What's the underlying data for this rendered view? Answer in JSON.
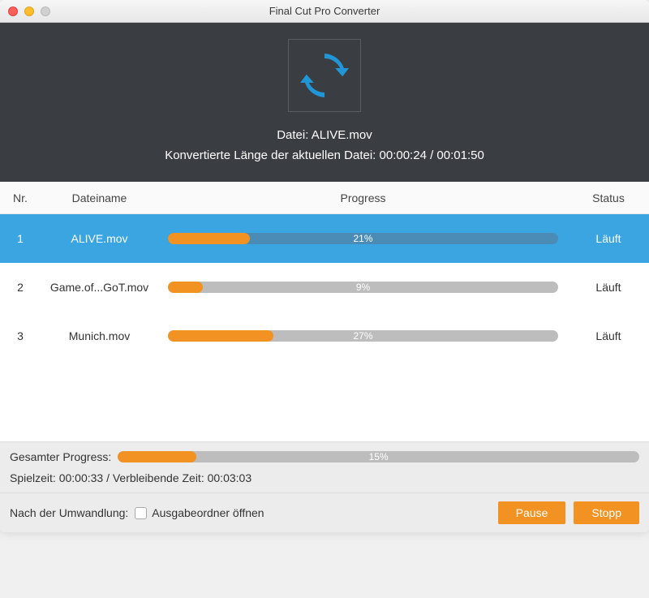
{
  "window": {
    "title": "Final Cut Pro Converter"
  },
  "header": {
    "file_label": "Datei: ALIVE.mov",
    "progress_text": "Konvertierte Länge der aktuellen Datei: 00:00:24 / 00:01:50"
  },
  "columns": {
    "nr": "Nr.",
    "name": "Dateiname",
    "progress": "Progress",
    "status": "Status"
  },
  "rows": [
    {
      "nr": "1",
      "name": "ALIVE.mov",
      "percent": 21,
      "percent_label": "21%",
      "status": "Läuft",
      "selected": true
    },
    {
      "nr": "2",
      "name": "Game.of...GoT.mov",
      "percent": 9,
      "percent_label": "9%",
      "status": "Läuft",
      "selected": false
    },
    {
      "nr": "3",
      "name": "Munich.mov",
      "percent": 27,
      "percent_label": "27%",
      "status": "Läuft",
      "selected": false
    }
  ],
  "overall": {
    "label": "Gesamter Progress:",
    "percent": 15,
    "percent_label": "15%",
    "time_text": "Spielzeit: 00:00:33 / Verbleibende Zeit: 00:03:03"
  },
  "after": {
    "label": "Nach der Umwandlung:",
    "checkbox_label": "Ausgabeordner öffnen"
  },
  "buttons": {
    "pause": "Pause",
    "stop": "Stopp"
  }
}
